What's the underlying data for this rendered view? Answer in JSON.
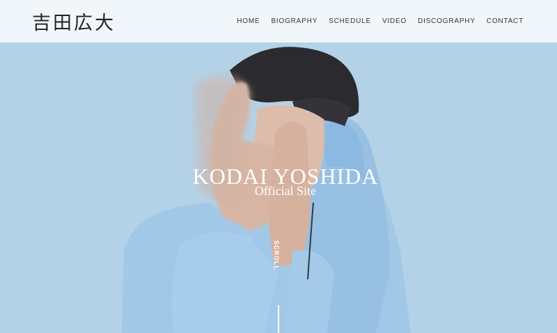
{
  "header": {
    "logo": "吉田広大",
    "nav": [
      "HOME",
      "BIOGRAPHY",
      "SCHEDULE",
      "VIDEO",
      "DISCOGRAPHY",
      "CONTACT"
    ]
  },
  "hero": {
    "title": "KODAI YOSHIDA",
    "subtitle": "Official Site",
    "scroll_label": "SCROLL"
  },
  "colors": {
    "header_bg": "#f1f6fa",
    "hero_bg": "#b3d2e7",
    "hoodie": "#9fc6e6",
    "hair": "#2b2a2e",
    "skin": "#d9b7a6"
  }
}
